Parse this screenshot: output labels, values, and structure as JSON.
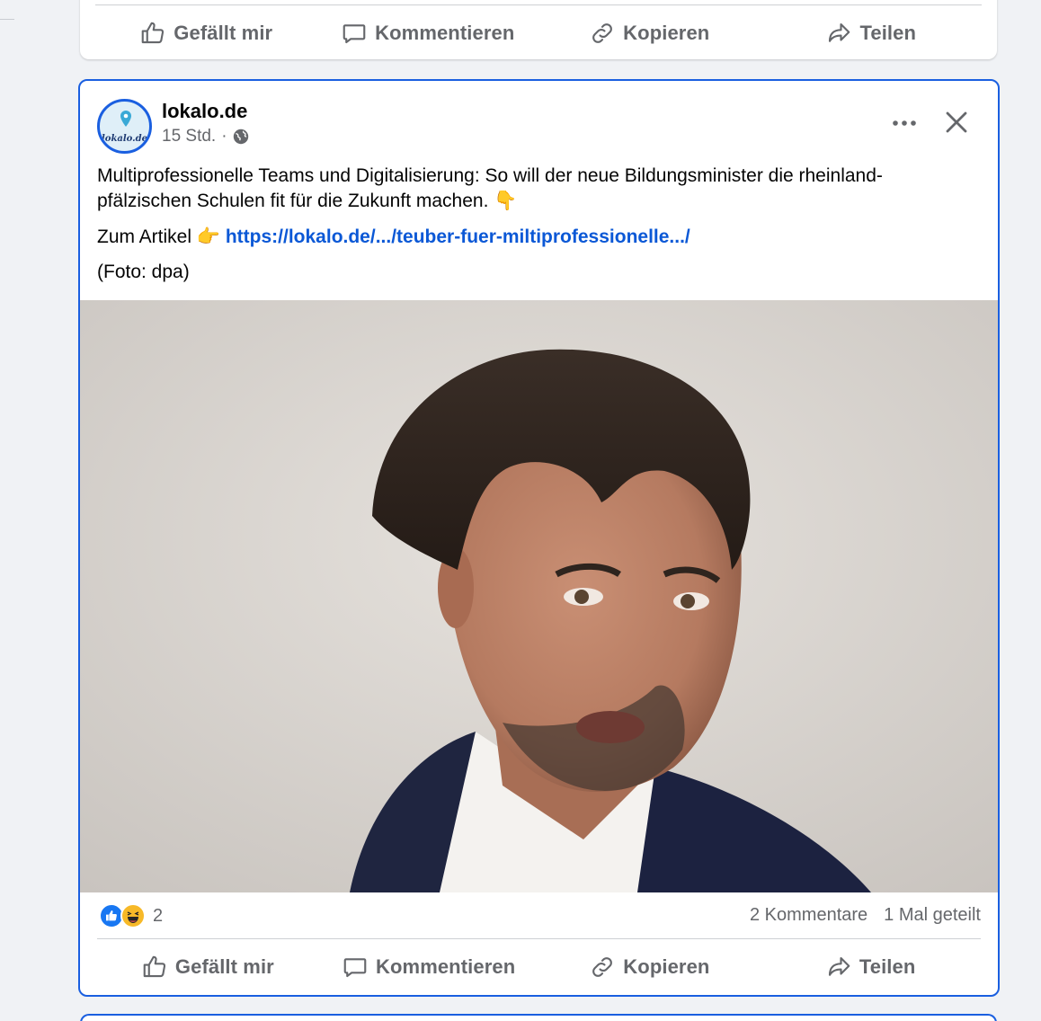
{
  "prev_post": {
    "actions": {
      "like": "Gefällt mir",
      "comment": "Kommentieren",
      "copy": "Kopieren",
      "share": "Teilen"
    }
  },
  "post": {
    "author": "lokalo.de",
    "avatar_text": "lokalo.de",
    "time": "15 Std.",
    "separator": "·",
    "audience_icon": "globe-icon",
    "text": "Multiprofessionelle Teams und Digitalisierung: So will der neue Bildungsminister die rheinland-pfälzischen Schulen fit für die Zukunft machen. 👇",
    "link_prefix": "Zum Artikel 👉",
    "link": "https://lokalo.de/.../teuber-fuer-miltiprofessionelle.../",
    "caption": "(Foto: dpa)",
    "reaction_count": "2",
    "comments": "2 Kommentare",
    "shares": "1 Mal geteilt",
    "actions": {
      "like": "Gefällt mir",
      "comment": "Kommentieren",
      "copy": "Kopieren",
      "share": "Teilen"
    }
  },
  "colors": {
    "accent": "#1a5fe0",
    "link": "#0b58d6",
    "secondary_text": "#65676b",
    "like_reaction": "#1877f2",
    "haha_reaction": "#f7b928"
  }
}
